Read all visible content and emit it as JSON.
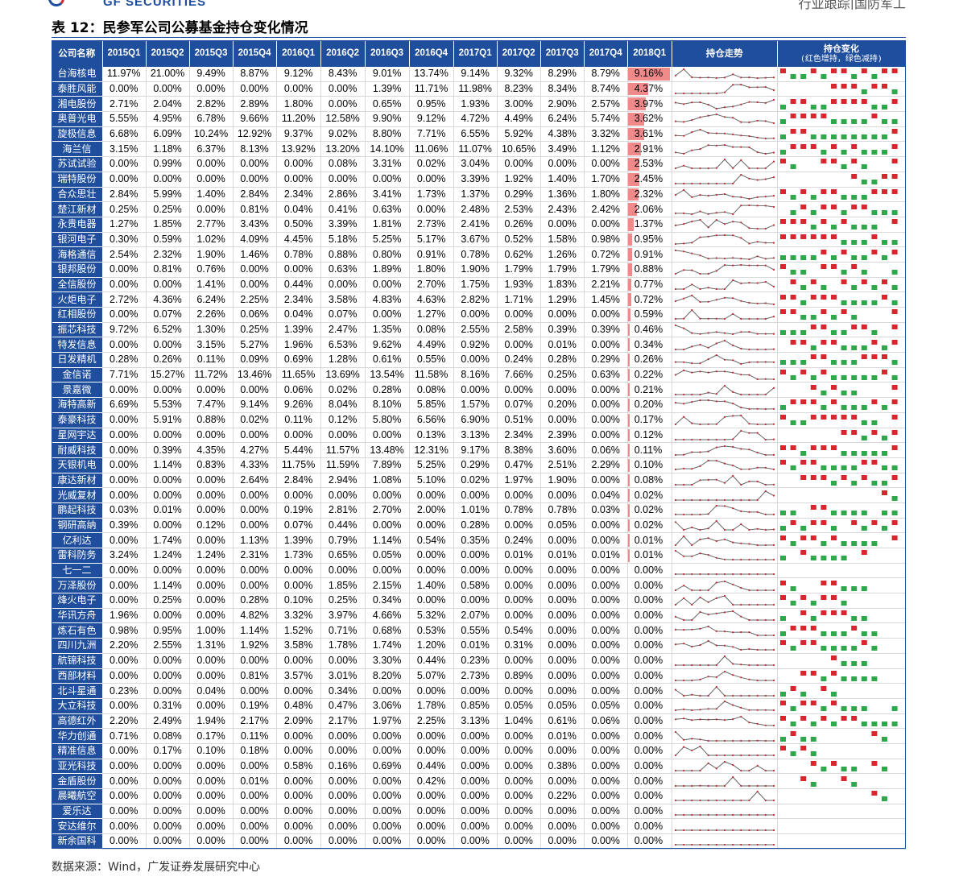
{
  "header": {
    "logo_text": "GF SECURITIES",
    "right_text": "行业跟踪|国防军工"
  },
  "title": "表 12：民参军公司公募基金持仓变化情况",
  "columns": {
    "name": "公司名称",
    "quarters": [
      "2015Q1",
      "2015Q2",
      "2015Q3",
      "2015Q4",
      "2016Q1",
      "2016Q2",
      "2016Q3",
      "2016Q4",
      "2017Q1",
      "2017Q2",
      "2017Q3",
      "2017Q4",
      "2018Q1"
    ],
    "trend": "持仓走势",
    "change": "持仓变化",
    "change_note": "(红色增持，绿色减持)"
  },
  "colors": {
    "header_bg": "#1f4e9c",
    "bar": "#f08a8a",
    "increase": "#d9262e",
    "decrease": "#2ea84a",
    "spark_line": "#666666",
    "spark_dot": "#c0272d"
  },
  "rows": [
    {
      "name": "台海核电",
      "values": [
        "11.97%",
        "21.00%",
        "9.49%",
        "8.87%",
        "9.12%",
        "8.43%",
        "9.01%",
        "13.74%",
        "9.14%",
        "9.32%",
        "8.29%",
        "8.79%",
        "9.16%"
      ]
    },
    {
      "name": "泰胜风能",
      "values": [
        "0.00%",
        "0.00%",
        "0.00%",
        "0.00%",
        "0.00%",
        "0.00%",
        "1.39%",
        "11.71%",
        "11.98%",
        "8.23%",
        "8.34%",
        "8.74%",
        "4.37%"
      ]
    },
    {
      "name": "湘电股份",
      "values": [
        "2.71%",
        "2.04%",
        "2.82%",
        "2.89%",
        "1.80%",
        "0.00%",
        "0.65%",
        "0.95%",
        "1.93%",
        "3.00%",
        "2.90%",
        "2.57%",
        "3.97%"
      ]
    },
    {
      "name": "奥普光电",
      "values": [
        "5.55%",
        "4.95%",
        "6.78%",
        "9.66%",
        "11.20%",
        "12.58%",
        "9.90%",
        "9.12%",
        "4.72%",
        "4.49%",
        "6.24%",
        "5.74%",
        "3.62%"
      ]
    },
    {
      "name": "旋极信息",
      "values": [
        "6.68%",
        "6.09%",
        "10.24%",
        "12.92%",
        "9.37%",
        "9.02%",
        "8.80%",
        "7.71%",
        "6.55%",
        "5.92%",
        "4.38%",
        "3.32%",
        "3.61%"
      ]
    },
    {
      "name": "海兰信",
      "values": [
        "3.15%",
        "1.18%",
        "6.37%",
        "8.13%",
        "13.92%",
        "13.20%",
        "14.10%",
        "11.06%",
        "11.07%",
        "10.65%",
        "3.49%",
        "1.12%",
        "2.91%"
      ]
    },
    {
      "name": "苏试试验",
      "values": [
        "0.00%",
        "0.99%",
        "0.00%",
        "0.00%",
        "0.00%",
        "0.08%",
        "3.31%",
        "0.02%",
        "3.04%",
        "0.00%",
        "0.00%",
        "0.00%",
        "2.53%"
      ]
    },
    {
      "name": "瑞特股份",
      "values": [
        "0.00%",
        "0.00%",
        "0.00%",
        "0.00%",
        "0.00%",
        "0.00%",
        "0.00%",
        "0.00%",
        "3.39%",
        "1.92%",
        "1.40%",
        "1.70%",
        "2.45%"
      ]
    },
    {
      "name": "合众思壮",
      "values": [
        "2.84%",
        "5.99%",
        "1.40%",
        "2.84%",
        "2.34%",
        "2.86%",
        "3.41%",
        "1.73%",
        "1.37%",
        "0.29%",
        "1.36%",
        "1.80%",
        "2.32%"
      ]
    },
    {
      "name": "楚江新材",
      "values": [
        "0.25%",
        "0.25%",
        "0.00%",
        "0.81%",
        "0.04%",
        "0.41%",
        "0.63%",
        "0.00%",
        "2.48%",
        "2.53%",
        "2.43%",
        "2.42%",
        "2.06%"
      ]
    },
    {
      "name": "永贵电器",
      "values": [
        "1.27%",
        "1.85%",
        "2.77%",
        "3.43%",
        "0.50%",
        "3.39%",
        "1.81%",
        "2.73%",
        "2.41%",
        "0.26%",
        "0.00%",
        "0.00%",
        "1.37%"
      ]
    },
    {
      "name": "银河电子",
      "values": [
        "0.30%",
        "0.59%",
        "1.02%",
        "4.09%",
        "4.45%",
        "5.18%",
        "5.25%",
        "5.17%",
        "3.67%",
        "0.52%",
        "1.58%",
        "0.98%",
        "0.95%"
      ]
    },
    {
      "name": "海格通信",
      "values": [
        "2.54%",
        "2.32%",
        "1.90%",
        "1.46%",
        "0.78%",
        "0.88%",
        "0.80%",
        "0.91%",
        "0.78%",
        "0.62%",
        "1.26%",
        "0.72%",
        "0.91%"
      ]
    },
    {
      "name": "银邦股份",
      "values": [
        "0.00%",
        "0.81%",
        "0.76%",
        "0.00%",
        "0.00%",
        "0.63%",
        "1.89%",
        "1.80%",
        "1.90%",
        "1.79%",
        "1.79%",
        "1.79%",
        "0.88%"
      ]
    },
    {
      "name": "全信股份",
      "values": [
        "0.00%",
        "0.00%",
        "1.41%",
        "0.00%",
        "0.44%",
        "0.00%",
        "0.00%",
        "2.70%",
        "1.75%",
        "1.93%",
        "1.83%",
        "2.21%",
        "0.77%"
      ]
    },
    {
      "name": "火炬电子",
      "values": [
        "2.72%",
        "4.36%",
        "6.24%",
        "2.25%",
        "2.34%",
        "3.58%",
        "4.83%",
        "4.63%",
        "2.82%",
        "1.71%",
        "1.29%",
        "1.45%",
        "0.72%"
      ]
    },
    {
      "name": "红相股份",
      "values": [
        "0.00%",
        "0.07%",
        "2.26%",
        "0.06%",
        "0.04%",
        "0.07%",
        "0.00%",
        "1.27%",
        "0.00%",
        "0.00%",
        "0.00%",
        "0.00%",
        "0.59%"
      ]
    },
    {
      "name": "振芯科技",
      "values": [
        "9.72%",
        "6.52%",
        "1.30%",
        "0.25%",
        "1.39%",
        "2.47%",
        "1.35%",
        "0.08%",
        "2.55%",
        "2.58%",
        "0.39%",
        "0.39%",
        "0.46%"
      ]
    },
    {
      "name": "特发信息",
      "values": [
        "0.00%",
        "0.00%",
        "3.15%",
        "5.27%",
        "1.96%",
        "6.53%",
        "9.62%",
        "4.49%",
        "0.92%",
        "0.00%",
        "0.01%",
        "0.00%",
        "0.34%"
      ]
    },
    {
      "name": "日发精机",
      "values": [
        "0.28%",
        "0.26%",
        "0.11%",
        "0.09%",
        "0.69%",
        "1.28%",
        "0.61%",
        "0.55%",
        "0.00%",
        "0.24%",
        "0.28%",
        "0.29%",
        "0.26%"
      ]
    },
    {
      "name": "金信诺",
      "values": [
        "7.71%",
        "15.27%",
        "11.72%",
        "13.46%",
        "11.65%",
        "13.69%",
        "13.54%",
        "11.58%",
        "8.16%",
        "7.66%",
        "0.25%",
        "0.63%",
        "0.22%"
      ]
    },
    {
      "name": "景嘉微",
      "values": [
        "0.00%",
        "0.00%",
        "0.00%",
        "0.00%",
        "0.06%",
        "0.02%",
        "0.28%",
        "0.08%",
        "0.00%",
        "0.00%",
        "0.00%",
        "0.00%",
        "0.21%"
      ]
    },
    {
      "name": "海特高新",
      "values": [
        "6.69%",
        "5.53%",
        "7.47%",
        "9.14%",
        "9.26%",
        "8.04%",
        "8.10%",
        "5.85%",
        "1.57%",
        "0.07%",
        "0.20%",
        "0.00%",
        "0.20%"
      ]
    },
    {
      "name": "泰豪科技",
      "values": [
        "0.00%",
        "5.91%",
        "0.88%",
        "0.02%",
        "0.11%",
        "0.12%",
        "5.80%",
        "6.56%",
        "6.90%",
        "0.51%",
        "0.00%",
        "0.00%",
        "0.17%"
      ]
    },
    {
      "name": "星网宇达",
      "values": [
        "0.00%",
        "0.00%",
        "0.00%",
        "0.00%",
        "0.00%",
        "0.00%",
        "0.00%",
        "0.13%",
        "3.13%",
        "2.34%",
        "2.39%",
        "0.00%",
        "0.12%"
      ]
    },
    {
      "name": "耐威科技",
      "values": [
        "0.00%",
        "0.39%",
        "4.35%",
        "4.27%",
        "5.44%",
        "11.57%",
        "13.48%",
        "12.31%",
        "9.17%",
        "8.38%",
        "3.60%",
        "0.06%",
        "0.11%"
      ]
    },
    {
      "name": "天银机电",
      "values": [
        "0.00%",
        "1.14%",
        "0.83%",
        "4.33%",
        "11.75%",
        "11.59%",
        "7.89%",
        "5.25%",
        "0.29%",
        "0.47%",
        "2.51%",
        "2.29%",
        "0.10%"
      ]
    },
    {
      "name": "康达新材",
      "values": [
        "0.00%",
        "0.00%",
        "0.00%",
        "2.64%",
        "2.84%",
        "2.94%",
        "1.08%",
        "5.10%",
        "0.02%",
        "1.97%",
        "1.90%",
        "0.00%",
        "0.08%"
      ]
    },
    {
      "name": "光威复材",
      "values": [
        "0.00%",
        "0.00%",
        "0.00%",
        "0.00%",
        "0.00%",
        "0.00%",
        "0.00%",
        "0.00%",
        "0.00%",
        "0.00%",
        "0.00%",
        "0.04%",
        "0.02%"
      ]
    },
    {
      "name": "鹏起科技",
      "values": [
        "0.03%",
        "0.01%",
        "0.00%",
        "0.00%",
        "0.19%",
        "2.81%",
        "2.70%",
        "2.00%",
        "1.01%",
        "0.78%",
        "0.78%",
        "0.03%",
        "0.02%"
      ]
    },
    {
      "name": "钢研高纳",
      "values": [
        "0.39%",
        "0.00%",
        "0.12%",
        "0.00%",
        "0.07%",
        "0.44%",
        "0.00%",
        "0.00%",
        "0.28%",
        "0.00%",
        "0.05%",
        "0.00%",
        "0.02%"
      ]
    },
    {
      "name": "亿利达",
      "values": [
        "0.00%",
        "1.74%",
        "0.00%",
        "1.13%",
        "1.39%",
        "0.79%",
        "1.14%",
        "0.54%",
        "0.35%",
        "0.24%",
        "0.00%",
        "0.00%",
        "0.01%"
      ]
    },
    {
      "name": "雷科防务",
      "values": [
        "3.24%",
        "1.24%",
        "1.24%",
        "2.31%",
        "1.73%",
        "0.65%",
        "0.05%",
        "0.00%",
        "0.00%",
        "0.01%",
        "0.01%",
        "0.01%",
        "0.01%"
      ]
    },
    {
      "name": "七一二",
      "values": [
        "0.00%",
        "0.00%",
        "0.00%",
        "0.00%",
        "0.00%",
        "0.00%",
        "0.00%",
        "0.00%",
        "0.00%",
        "0.00%",
        "0.00%",
        "0.00%",
        "0.00%"
      ]
    },
    {
      "name": "万泽股份",
      "values": [
        "0.00%",
        "1.14%",
        "0.00%",
        "0.00%",
        "0.00%",
        "1.85%",
        "2.15%",
        "1.40%",
        "0.58%",
        "0.00%",
        "0.00%",
        "0.00%",
        "0.00%"
      ]
    },
    {
      "name": "烽火电子",
      "values": [
        "0.00%",
        "0.25%",
        "0.00%",
        "0.28%",
        "0.10%",
        "0.25%",
        "0.34%",
        "0.00%",
        "0.00%",
        "0.00%",
        "0.00%",
        "0.00%",
        "0.00%"
      ]
    },
    {
      "name": "华讯方舟",
      "values": [
        "1.96%",
        "0.00%",
        "0.00%",
        "4.82%",
        "3.32%",
        "3.97%",
        "4.66%",
        "5.32%",
        "2.07%",
        "0.00%",
        "0.00%",
        "0.00%",
        "0.00%"
      ]
    },
    {
      "name": "炼石有色",
      "values": [
        "0.98%",
        "0.95%",
        "1.00%",
        "1.14%",
        "1.52%",
        "0.71%",
        "0.68%",
        "0.53%",
        "0.55%",
        "0.54%",
        "0.00%",
        "0.00%",
        "0.00%"
      ]
    },
    {
      "name": "四川九洲",
      "values": [
        "2.20%",
        "2.55%",
        "1.31%",
        "1.92%",
        "3.58%",
        "1.78%",
        "1.74%",
        "1.20%",
        "0.01%",
        "0.31%",
        "0.00%",
        "0.00%",
        "0.00%"
      ]
    },
    {
      "name": "航锦科技",
      "values": [
        "0.00%",
        "0.00%",
        "0.00%",
        "0.00%",
        "0.00%",
        "0.00%",
        "3.30%",
        "0.44%",
        "0.23%",
        "0.00%",
        "0.00%",
        "0.00%",
        "0.00%"
      ]
    },
    {
      "name": "西部材料",
      "values": [
        "0.00%",
        "0.00%",
        "0.00%",
        "0.81%",
        "3.57%",
        "3.01%",
        "8.20%",
        "5.07%",
        "2.73%",
        "0.89%",
        "0.00%",
        "0.00%",
        "0.00%"
      ]
    },
    {
      "name": "北斗星通",
      "values": [
        "0.23%",
        "0.00%",
        "0.04%",
        "0.00%",
        "0.00%",
        "0.34%",
        "0.00%",
        "0.00%",
        "0.00%",
        "0.00%",
        "0.00%",
        "0.00%",
        "0.00%"
      ]
    },
    {
      "name": "大立科技",
      "values": [
        "0.00%",
        "0.31%",
        "0.00%",
        "0.19%",
        "0.48%",
        "0.47%",
        "3.06%",
        "1.78%",
        "0.85%",
        "0.05%",
        "0.05%",
        "0.05%",
        "0.00%"
      ]
    },
    {
      "name": "高德红外",
      "values": [
        "2.20%",
        "2.49%",
        "1.94%",
        "2.17%",
        "2.09%",
        "2.17%",
        "1.97%",
        "2.25%",
        "3.13%",
        "1.04%",
        "0.61%",
        "0.06%",
        "0.00%"
      ]
    },
    {
      "name": "华力创通",
      "values": [
        "0.71%",
        "0.08%",
        "0.17%",
        "0.11%",
        "0.00%",
        "0.00%",
        "0.00%",
        "0.00%",
        "0.00%",
        "0.00%",
        "0.01%",
        "0.00%",
        "0.00%"
      ]
    },
    {
      "name": "精准信息",
      "values": [
        "0.00%",
        "0.17%",
        "0.10%",
        "0.18%",
        "0.00%",
        "0.00%",
        "0.00%",
        "0.00%",
        "0.00%",
        "0.00%",
        "0.00%",
        "0.00%",
        "0.00%"
      ]
    },
    {
      "name": "亚光科技",
      "values": [
        "0.00%",
        "0.00%",
        "0.00%",
        "0.00%",
        "0.58%",
        "0.16%",
        "0.69%",
        "0.44%",
        "0.00%",
        "0.00%",
        "0.38%",
        "0.00%",
        "0.00%"
      ]
    },
    {
      "name": "金盾股份",
      "values": [
        "0.00%",
        "0.00%",
        "0.00%",
        "0.01%",
        "0.00%",
        "0.00%",
        "0.00%",
        "0.42%",
        "0.00%",
        "0.00%",
        "0.00%",
        "0.00%",
        "0.00%"
      ]
    },
    {
      "name": "晨曦航空",
      "values": [
        "0.00%",
        "0.00%",
        "0.00%",
        "0.00%",
        "0.00%",
        "0.00%",
        "0.00%",
        "0.00%",
        "0.00%",
        "0.00%",
        "0.22%",
        "0.00%",
        "0.00%"
      ]
    },
    {
      "name": "爱乐达",
      "values": [
        "0.00%",
        "0.00%",
        "0.00%",
        "0.00%",
        "0.00%",
        "0.00%",
        "0.00%",
        "0.00%",
        "0.00%",
        "0.00%",
        "0.00%",
        "0.00%",
        "0.00%"
      ]
    },
    {
      "name": "安达维尔",
      "values": [
        "0.00%",
        "0.00%",
        "0.00%",
        "0.00%",
        "0.00%",
        "0.00%",
        "0.00%",
        "0.00%",
        "0.00%",
        "0.00%",
        "0.00%",
        "0.00%",
        "0.00%"
      ]
    },
    {
      "name": "新余国科",
      "values": [
        "0.00%",
        "0.00%",
        "0.00%",
        "0.00%",
        "0.00%",
        "0.00%",
        "0.00%",
        "0.00%",
        "0.00%",
        "0.00%",
        "0.00%",
        "0.00%",
        "0.00%"
      ]
    }
  ],
  "source": "数据来源：Wind，广发证券发展研究中心"
}
